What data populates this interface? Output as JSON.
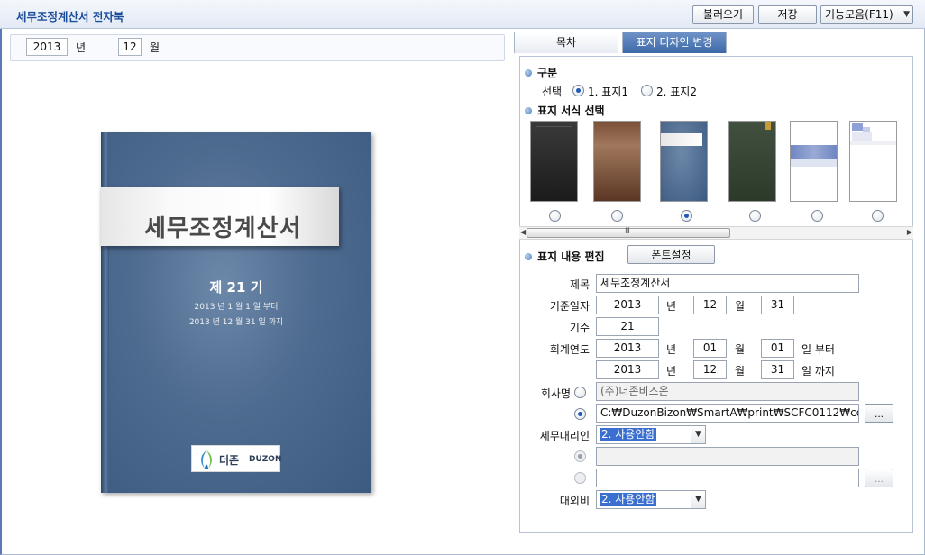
{
  "window": {
    "title": "세무조정계산서 전자북"
  },
  "toolbar": {
    "load": "불러오기",
    "save": "저장",
    "functions": "기능모음(F11)",
    "dropdown_icon": "chevron-down-icon"
  },
  "left": {
    "year": "2013",
    "year_unit": "년",
    "month": "12",
    "month_unit": "월",
    "cover": {
      "title": "세무조정계산서",
      "term": "제 21 기",
      "from_line": "2013 년  1 월  1 일 부터",
      "to_line": "2013 년 12 월 31 일 까지",
      "logo_ko": "더존",
      "logo_en": "DUZON"
    }
  },
  "tabs": [
    {
      "label": "목차"
    },
    {
      "label": "표지 디자인 변경"
    }
  ],
  "section_type": {
    "title": "구분",
    "select_label": "선택",
    "options": [
      {
        "label": "1. 표지1",
        "selected": true
      },
      {
        "label": "2. 표지2",
        "selected": false
      }
    ]
  },
  "section_style": {
    "title": "표지 서식 선택",
    "thumbnails": [
      {
        "name": "black-cover",
        "selected": false
      },
      {
        "name": "brown-cover",
        "selected": false
      },
      {
        "name": "blue-cover",
        "selected": true
      },
      {
        "name": "green-cover",
        "selected": false
      },
      {
        "name": "white-blue-cover",
        "selected": false
      },
      {
        "name": "white-pixel-cover",
        "selected": false
      }
    ],
    "scroll_grip": "III"
  },
  "section_edit": {
    "title": "표지 내용 편집",
    "font_button": "폰트설정",
    "title_label": "제목",
    "title_value": "세무조정계산서",
    "base_date_label": "기준일자",
    "base_year": "2013",
    "base_month": "12",
    "base_day": "31",
    "term_label": "기수",
    "term_value": "21",
    "fiscal_label": "회계연도",
    "from_year": "2013",
    "from_month": "01",
    "from_day": "01",
    "from_suffix": "일 부터",
    "to_year": "2013",
    "to_month": "12",
    "to_day": "31",
    "to_suffix": "일 까지",
    "unit_year": "년",
    "unit_month": "월",
    "company_label": "회사명",
    "company_value": "(주)더존비즈온",
    "company_path": "C:₩DuzonBizon₩SmartA₩print₩SCFC0112₩co",
    "browse": "...",
    "agent_label": "세무대리인",
    "agent_value": "2. 사용안함",
    "external_label": "대외비",
    "external_value": "2. 사용안함"
  }
}
